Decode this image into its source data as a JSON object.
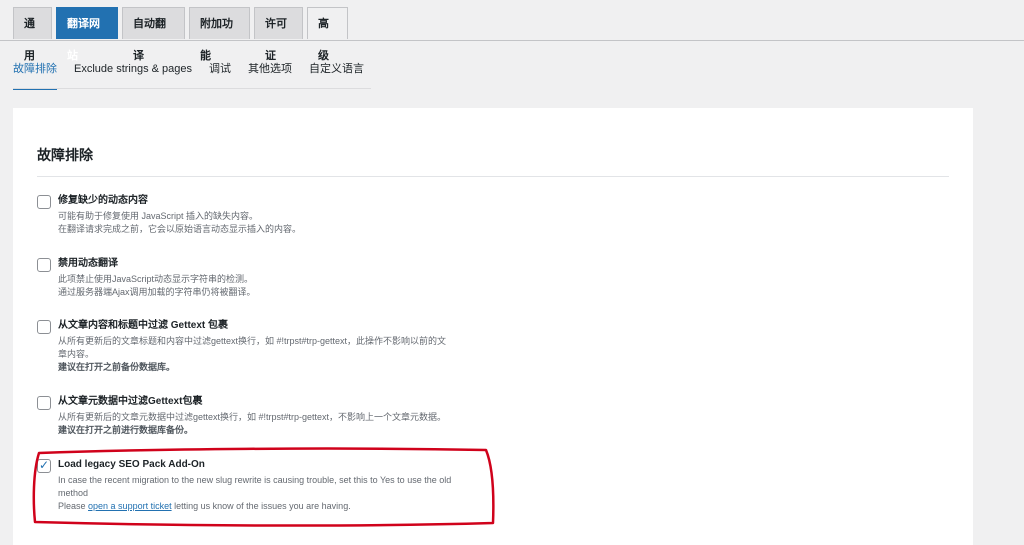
{
  "top_tabs": [
    "通用",
    "翻译网站",
    "自动翻译",
    "附加功能",
    "许可证",
    "高级"
  ],
  "sub_tabs": [
    "故障排除",
    "Exclude strings & pages",
    "调试",
    "其他选项",
    "自定义语言"
  ],
  "panel": {
    "title": "故障排除",
    "options": [
      {
        "title": "修复缺少的动态内容",
        "lines": [
          "可能有助于修复使用 JavaScript 插入的缺失内容。",
          "在翻译请求完成之前，它会以原始语言动态显示插入的内容。"
        ],
        "checked": false
      },
      {
        "title": "禁用动态翻译",
        "lines": [
          "此项禁止使用JavaScript动态显示字符串的检测。",
          "通过服务器端Ajax调用加载的字符串仍将被翻译。"
        ],
        "checked": false
      },
      {
        "title": "从文章内容和标题中过滤 Gettext 包裹",
        "lines": [
          "从所有更新后的文章标题和内容中过滤gettext换行，如 #!trpst#trp-gettext，此操作不影响以前的文",
          "章内容。"
        ],
        "bold_line": "建议在打开之前备份数据库。",
        "checked": false
      },
      {
        "title": "从文章元数据中过滤Gettext包裹",
        "lines": [
          "从所有更新后的文章元数据中过滤gettext换行，如 #!trpst#trp-gettext，不影响上一个文章元数据。"
        ],
        "bold_line": "建议在打开之前进行数据库备份。",
        "checked": false
      },
      {
        "title": "Load legacy SEO Pack Add-On",
        "lines": [
          "In case the recent migration to the new slug rewrite is causing trouble, set this to Yes to use the old",
          "method"
        ],
        "link_prefix": "Please ",
        "link_text": "open a support ticket",
        "link_suffix": " letting us know of the issues you are having.",
        "checked": true
      }
    ]
  },
  "colors": {
    "accent": "#2271b1",
    "annotation": "#d0021b"
  },
  "icons": {
    "checkbox_tick": "checkmark-icon"
  }
}
